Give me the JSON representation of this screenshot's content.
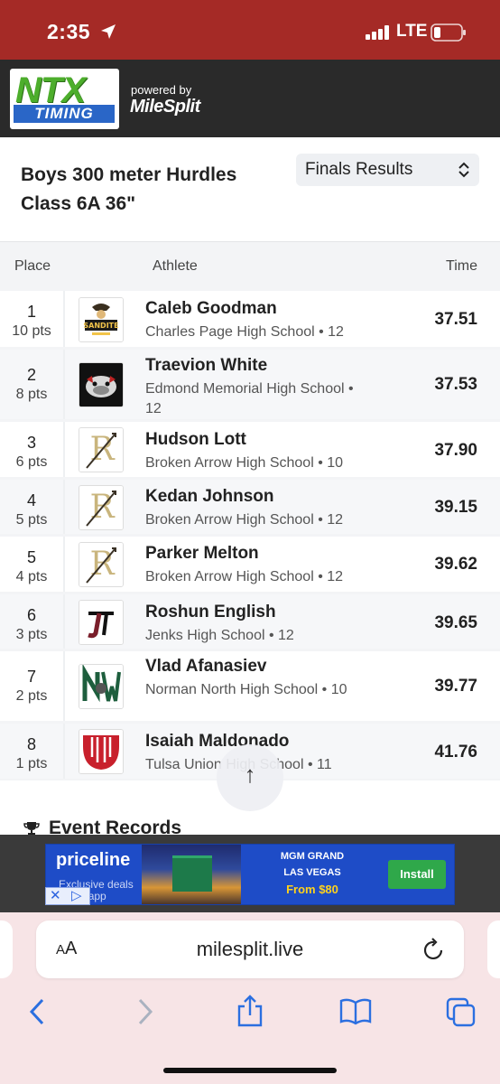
{
  "status_bar": {
    "time": "2:35",
    "network": "LTE"
  },
  "site_header": {
    "logo_top": "NTX",
    "logo_bottom": "TIMING",
    "powered_by": "powered by",
    "brand": "MileSplit"
  },
  "event": {
    "title_line1": "Boys 300 meter Hurdles",
    "title_line2": "Class 6A 36\"",
    "results_select": "Finals Results"
  },
  "table": {
    "headers": {
      "place": "Place",
      "athlete": "Athlete",
      "time": "Time"
    },
    "rows": [
      {
        "place": "1",
        "points": "10 pts",
        "name": "Caleb Goodman",
        "school": "Charles Page High School • 12",
        "time": "37.51",
        "logo": "sand-springs-sandites-logo"
      },
      {
        "place": "2",
        "points": "8 pts",
        "name": "Traevion White",
        "school": "Edmond Memorial High School • 12",
        "time": "37.53",
        "logo": "bulldog-logo"
      },
      {
        "place": "3",
        "points": "6 pts",
        "name": "Hudson Lott",
        "school": "Broken Arrow High School • 10",
        "time": "37.90",
        "logo": "broken-arrow-logo"
      },
      {
        "place": "4",
        "points": "5 pts",
        "name": "Kedan Johnson",
        "school": "Broken Arrow High School • 12",
        "time": "39.15",
        "logo": "broken-arrow-logo"
      },
      {
        "place": "5",
        "points": "4 pts",
        "name": "Parker Melton",
        "school": "Broken Arrow High School • 12",
        "time": "39.62",
        "logo": "broken-arrow-logo"
      },
      {
        "place": "6",
        "points": "3 pts",
        "name": "Roshun English",
        "school": "Jenks High School • 12",
        "time": "39.65",
        "logo": "jenks-jt-logo"
      },
      {
        "place": "7",
        "points": "2 pts",
        "name": "Vlad Afanasiev",
        "school": "Norman North High School • 10",
        "time": "39.77",
        "logo": "norman-north-logo"
      },
      {
        "place": "8",
        "points": "1 pts",
        "name": "Isaiah Maldonado",
        "school": "Tulsa Union High School • 11",
        "time": "41.76",
        "logo": "tulsa-union-logo"
      }
    ]
  },
  "records_heading": "Event Records",
  "ad": {
    "brand": "priceline",
    "tagline": "Exclusive deals in the app",
    "hotel": "MGM GRAND",
    "city": "LAS VEGAS",
    "price": "From $80",
    "cta": "Install"
  },
  "browser": {
    "aa_label": "AA",
    "url": "milesplit.live"
  },
  "colors": {
    "status_bar": "#a52a26",
    "site_header": "#2a2a2a",
    "ad_blue": "#1e4cc7",
    "install_green": "#2fa84a",
    "browser_bg": "#f7e4e6",
    "toolbar_icons": "#2b6fe0"
  }
}
